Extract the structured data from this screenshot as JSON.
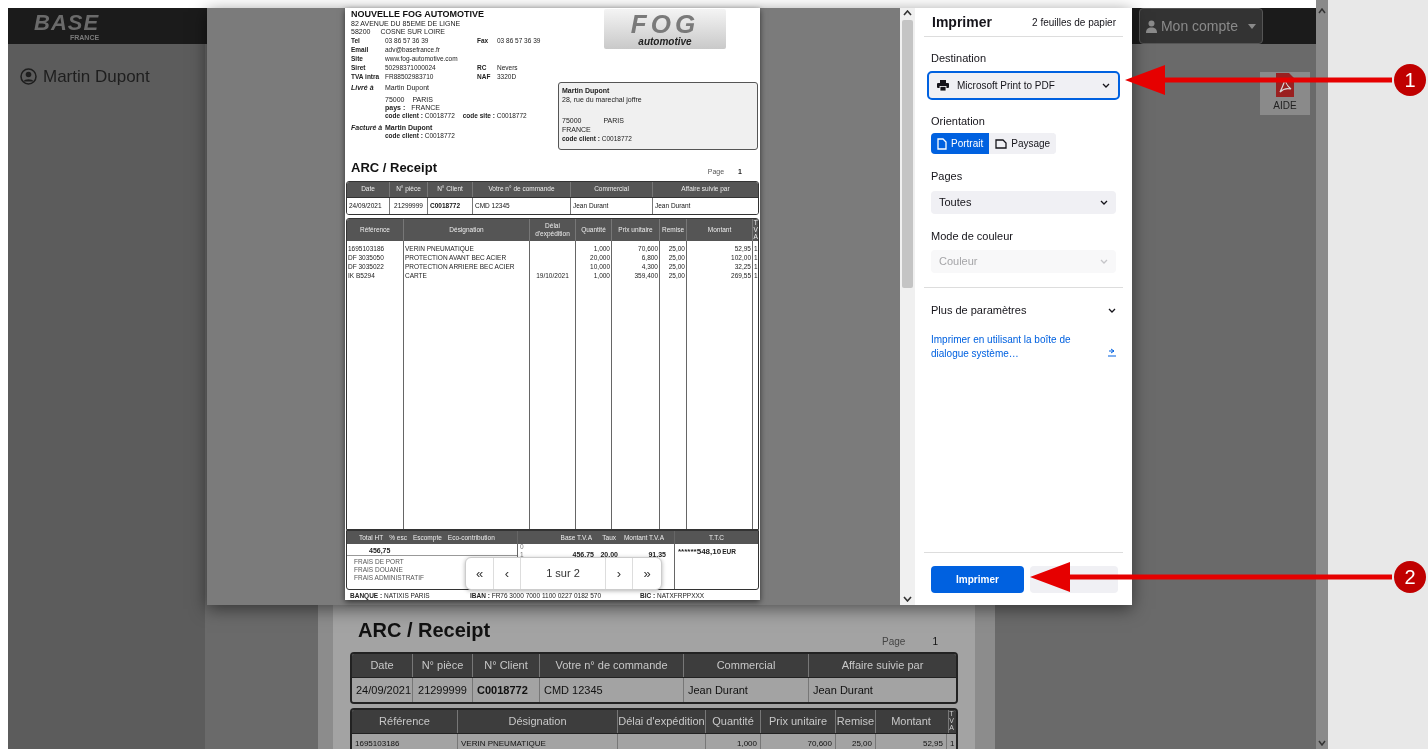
{
  "app": {
    "logo": "BASE",
    "logo_sub": "FRANCE",
    "user": "Martin Dupont",
    "account_button": "Mon compte",
    "help_label": "AIDE"
  },
  "background_document": {
    "title": "ARC / Receipt",
    "page_label": "Page",
    "page_number": "1",
    "header_columns": [
      "Date",
      "N° pièce",
      "N° Client",
      "Votre n° de commande",
      "Commercial",
      "Affaire suivie par"
    ],
    "header_values": [
      "24/09/2021",
      "21299999",
      "C0018772",
      "CMD 12345",
      "Jean Durant",
      "Jean Durant"
    ],
    "line_columns": [
      "Référence",
      "Désignation",
      "Délai d'expédition",
      "Quantité",
      "Prix unitaire",
      "Remise",
      "Montant",
      "TVA"
    ],
    "lines": [
      {
        "reference": "1695103186",
        "designation": "VERIN PNEUMATIQUE",
        "quantity": "1,000",
        "unit_price": "70,600",
        "discount": "25,00",
        "amount": "52,95",
        "vat": "1"
      }
    ]
  },
  "print_preview": {
    "document": {
      "company": {
        "name": "NOUVELLE FOG AUTOMOTIVE",
        "address": "82 AVENUE DU 85EME DE LIGNE",
        "postcode": "58200",
        "city": "COSNE SUR LOIRE",
        "info": [
          {
            "label": "Tel",
            "value": "03 86 57 36 39",
            "label2": "Fax",
            "value2": "03 86 57 36 39"
          },
          {
            "label": "Email",
            "value": "adv@basefrance.fr"
          },
          {
            "label": "Site",
            "value": "www.fog-automotive.com"
          },
          {
            "label": "Siret",
            "value": "50298371000024",
            "label2": "RC",
            "value2": "Nevers"
          },
          {
            "label": "TVA intra",
            "value": "FR88502983710",
            "label2": "NAF",
            "value2": "3320D"
          }
        ]
      },
      "logo": {
        "mark": "FOG",
        "tagline": "automotive"
      },
      "delivery": {
        "label": "Livré à",
        "name": "Martin Dupont",
        "postcode": "75000",
        "city": "PARIS",
        "country_label": "pays :",
        "country": "FRANCE",
        "client_code": "**code client :** C0018772",
        "site_code": "**code site :** C0018772"
      },
      "billing": {
        "label": "Facturé à",
        "name": "Martin Dupont",
        "client_code": "**code client :** C0018772"
      },
      "address_box": {
        "name": "Martin Dupont",
        "street": "28, rue du marechal joffre",
        "postcode": "75000",
        "city": "PARIS",
        "country": "FRANCE",
        "client_code": "**code client :** C0018772"
      },
      "title": "ARC / Receipt",
      "page_label": "Page",
      "page_number": "1",
      "header_columns": [
        "Date",
        "N° pièce",
        "N° Client",
        "Votre n° de commande",
        "Commercial",
        "Affaire suivie par"
      ],
      "header_values": [
        "24/09/2021",
        "21299999",
        "C0018772",
        "CMD 12345",
        "Jean Durant",
        "Jean Durant"
      ],
      "line_columns": [
        "Référence",
        "Désignation",
        "Délai d'expédition",
        "Quantité",
        "Prix unitaire",
        "Remise",
        "Montant",
        "TVA"
      ],
      "lines": [
        {
          "reference": "1695103186",
          "designation": "VERIN PNEUMATIQUE",
          "quantity": "1,000",
          "unit_price": "70,600",
          "discount": "25,00",
          "amount": "52,95",
          "vat": "1"
        },
        {
          "reference": "DF 3035050",
          "designation": "PROTECTION AVANT BEC ACIER",
          "quantity": "20,000",
          "unit_price": "6,800",
          "discount": "25,00",
          "amount": "102,00",
          "vat": "1"
        },
        {
          "reference": "DF 3035022",
          "designation": "PROTECTION ARRIERE BEC ACIER",
          "quantity": "10,000",
          "unit_price": "4,300",
          "discount": "25,00",
          "amount": "32,25",
          "vat": "1"
        },
        {
          "reference": "IK B5294",
          "designation": "CARTE",
          "lead_time": "19/10/2021",
          "quantity": "1,000",
          "unit_price": "359,400",
          "discount": "25,00",
          "amount": "269,55",
          "vat": "1"
        }
      ],
      "totals": {
        "columns": [
          "Total HT",
          "% esc",
          "Escompte",
          "Eco-contribution"
        ],
        "total_ht": "456,75",
        "fees": [
          "FRAIS DE PORT",
          "FRAIS DOUANE",
          "FRAIS ADMINISTRATIF"
        ],
        "vat_columns": [
          "Base T.V.A",
          "Taux",
          "Montant T.V.A"
        ],
        "vat_rows": [
          [
            "0"
          ],
          [
            "1",
            "456,75",
            "20,00",
            "91,35"
          ]
        ],
        "ttc_label": "T.T.C",
        "ttc": "******548,10",
        "currency": "EUR"
      },
      "bank": [
        "**BANQUE :** NATIXIS PARIS",
        "**IBAN :** FR76 3000 7000 1100 0227 0182 570",
        "**BIC :** NATXFRPPXXX"
      ]
    },
    "pager": {
      "first": "«",
      "previous": "‹",
      "label": "1 sur 2",
      "next": "›",
      "last": "»"
    }
  },
  "print_panel": {
    "title": "Imprimer",
    "sheets": "2 feuilles de papier",
    "destination": {
      "label": "Destination",
      "value": "Microsoft Print to PDF"
    },
    "orientation": {
      "label": "Orientation",
      "options": [
        {
          "label": "Portrait",
          "selected": true
        },
        {
          "label": "Paysage",
          "selected": false
        }
      ]
    },
    "pages": {
      "label": "Pages",
      "value": "Toutes"
    },
    "color_mode": {
      "label": "Mode de couleur",
      "value": "Couleur",
      "disabled": true
    },
    "more_settings": {
      "label": "Plus de paramètres",
      "expanded": false
    },
    "system_dialog_link": "Imprimer en utilisant la boîte de dialogue système…",
    "print_button": "Imprimer"
  },
  "annotations": [
    {
      "number": "1"
    },
    {
      "number": "2"
    }
  ]
}
